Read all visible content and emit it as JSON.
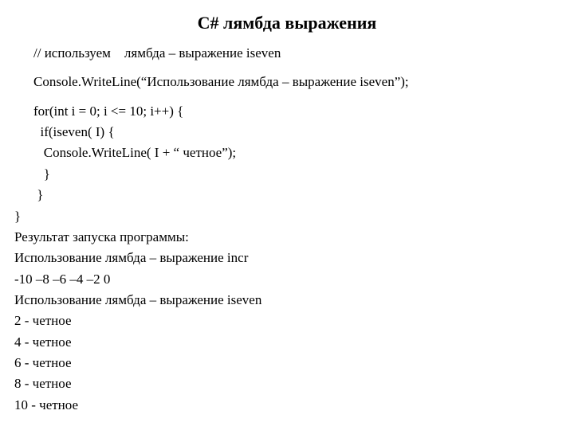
{
  "title": "C#   лямбда выражения",
  "code": {
    "l1": "// используем    лямбда – выражение iseven",
    "l2": "Console.WriteLine(“Использование лямбда – выражение iseven”);",
    "l3": "for(int i = 0; i <= 10; i++) {",
    "l4": "  if(iseven( I) {",
    "l5": "   Console.WriteLine( I + “ четное”);",
    "l6": "   }",
    "l7": " }",
    "l8": "}"
  },
  "output": {
    "o1": "Результат запуска программы:",
    "o2": "Использование лямбда – выражение incr",
    "o3": "-10 –8 –6 –4 –2 0",
    "o4": "Использование лямбда – выражение iseven",
    "o5": "2 - четное",
    "o6": "4 - четное",
    "o7": "6 - четное",
    "o8": "8 - четное",
    "o9": "10 - четное"
  }
}
